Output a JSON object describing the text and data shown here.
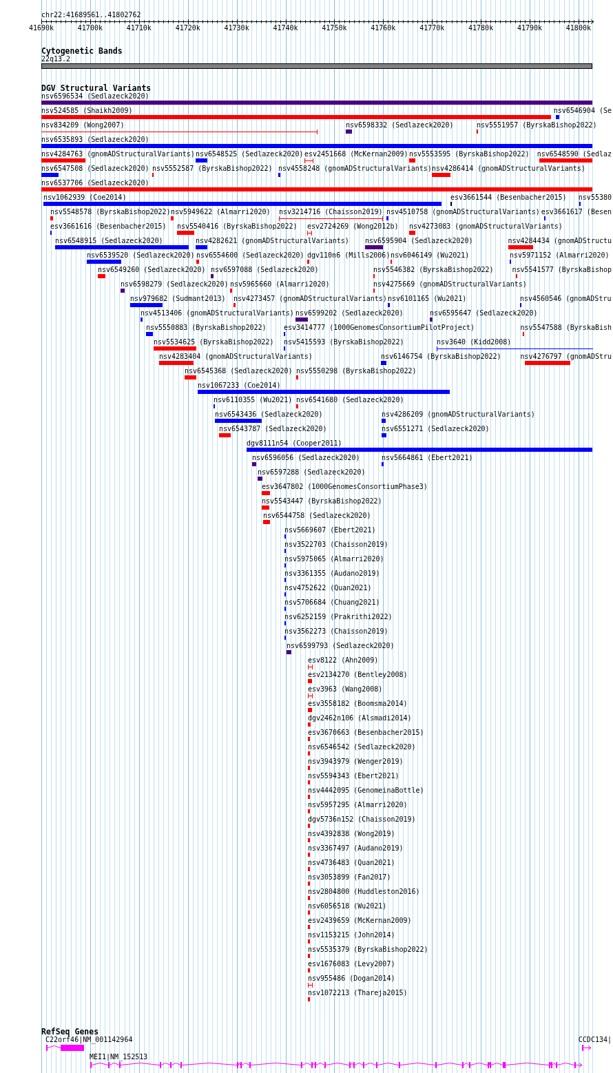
{
  "locus": "chr22:41689561..41802762",
  "ruler": {
    "ticks": [
      "41690k",
      "41700k",
      "41710k",
      "41720k",
      "41730k",
      "41740k",
      "41750k",
      "41760k",
      "41770k",
      "41780k",
      "41790k",
      "41800k"
    ]
  },
  "cytoband_track": {
    "title": "Cytogenetic Bands",
    "band": "22q13.2"
  },
  "dgv_track": {
    "title": "DGV Structural Variants",
    "features": [
      {
        "label": "nsv6596534 (Sedlazeck2020)",
        "color": "#4b0082",
        "kind": "block"
      },
      {
        "label": "nsv524585 (Shaikh2009)",
        "color": "#ff0000",
        "kind": "block"
      },
      {
        "label": "nsv6546904 (Se",
        "color": "#0000ff",
        "kind": "block"
      },
      {
        "label": "nsv834209 (Wong2007)",
        "color": "#ff0000",
        "kind": "span"
      },
      {
        "label": "nsv6598332 (Sedlazeck2020)",
        "color": "#4b0082",
        "kind": "block"
      },
      {
        "label": "nsv5551957 (ByrskaBishop2022)",
        "color": "#ff0000",
        "kind": "block"
      },
      {
        "label": "nsv6535893 (Sedlazeck2020)",
        "color": "#0000ff",
        "kind": "block"
      },
      {
        "label": "nsv4284763 (gnomADStructuralVariants)",
        "color": "#ff0000",
        "kind": "block"
      },
      {
        "label": "nsv6548525 (Sedlazeck2020)",
        "color": "#0000ff",
        "kind": "block"
      },
      {
        "label": "esv2451668 (McKernan2009)",
        "color": "#ff0000",
        "kind": "span"
      },
      {
        "label": "nsv5553595 (ByrskaBishop2022)",
        "color": "#ff0000",
        "kind": "block"
      },
      {
        "label": "nsv6548590 (Sedlaz",
        "color": "#ff0000",
        "kind": "block"
      },
      {
        "label": "nsv6547508 (Sedlazeck2020)",
        "color": "#0000ff",
        "kind": "block"
      },
      {
        "label": "nsv5552587 (ByrskaBishop2022)",
        "color": "#ff0000",
        "kind": "block"
      },
      {
        "label": "nsv4558248 (gnomADStructuralVariants)",
        "color": "#0000ff",
        "kind": "block"
      },
      {
        "label": "nsv4286414 (gnomADStructuralVariants)",
        "color": "#ff0000",
        "kind": "block"
      },
      {
        "label": "nsv6537706 (Sedlazeck2020)",
        "color": "#ff0000",
        "kind": "block"
      },
      {
        "label": "nsv1062939 (Coe2014)",
        "color": "#0000ff",
        "kind": "block"
      },
      {
        "label": "esv3661544 (Besenbacher2015)",
        "color": "#000000",
        "kind": "block"
      },
      {
        "label": "nsv55380",
        "color": "#0000ff",
        "kind": "block"
      },
      {
        "label": "nsv5548578 (ByrskaBishop2022)",
        "color": "#ff0000",
        "kind": "block"
      },
      {
        "label": "nsv5949622 (Almarri2020)",
        "color": "#ff0000",
        "kind": "block"
      },
      {
        "label": "nsv3214716 (Chaisson2019)",
        "color": "#ff0000",
        "kind": "span"
      },
      {
        "label": "nsv4510758 (gnomADStructuralVariants)",
        "color": "#0000ff",
        "kind": "block"
      },
      {
        "label": "esv3661617 (Besen",
        "color": "#0000ff",
        "kind": "block"
      },
      {
        "label": "esv3661616 (Besenbacher2015)",
        "color": "#0000ff",
        "kind": "block"
      },
      {
        "label": "nsv5540416 (ByrskaBishop2022)",
        "color": "#ff0000",
        "kind": "block"
      },
      {
        "label": "esv2724269 (Wong2012b)",
        "color": "#ff0000",
        "kind": "span"
      },
      {
        "label": "nsv4273083 (gnomADStructuralVariants)",
        "color": "#ff0000",
        "kind": "block"
      },
      {
        "label": "nsv6548915 (Sedlazeck2020)",
        "color": "#0000ff",
        "kind": "block"
      },
      {
        "label": "nsv4282621 (gnomADStructuralVariants)",
        "color": "#0000ff",
        "kind": "block"
      },
      {
        "label": "nsv6595904 (Sedlazeck2020)",
        "color": "#4b0082",
        "kind": "block"
      },
      {
        "label": "nsv4284434 (gnomADStructu",
        "color": "#ff0000",
        "kind": "block"
      },
      {
        "label": "nsv6539520 (Sedlazeck2020)",
        "color": "#0000ff",
        "kind": "block"
      },
      {
        "label": "nsv6554600 (Sedlazeck2020)",
        "color": "#ff0000",
        "kind": "block"
      },
      {
        "label": "dgv110n6 (Mills2006)",
        "color": "#ff0000",
        "kind": "block"
      },
      {
        "label": "nsv6046149 (Wu2021)",
        "color": "#ff0000",
        "kind": "block"
      },
      {
        "label": "nsv5971152 (Almarri2020)",
        "color": "#0000ff",
        "kind": "block"
      },
      {
        "label": "nsv6549260 (Sedlazeck2020)",
        "color": "#ff0000",
        "kind": "block"
      },
      {
        "label": "nsv6597088 (Sedlazeck2020)",
        "color": "#4b0082",
        "kind": "block"
      },
      {
        "label": "nsv5546382 (ByrskaBishop2022)",
        "color": "#ff0000",
        "kind": "block"
      },
      {
        "label": "nsv5541577 (ByrskaBishop",
        "color": "#ff0000",
        "kind": "block"
      },
      {
        "label": "nsv6598279 (Sedlazeck2020)",
        "color": "#4b0082",
        "kind": "block"
      },
      {
        "label": "nsv5965660 (Almarri2020)",
        "color": "#ff0000",
        "kind": "block"
      },
      {
        "label": "nsv4275669 (gnomADStructuralVariants)",
        "color": "#ff0000",
        "kind": "block"
      },
      {
        "label": "nsv979682 (Sudmant2013)",
        "color": "#0000ff",
        "kind": "block"
      },
      {
        "label": "nsv4273457 (gnomADStructuralVariants)",
        "color": "#ff0000",
        "kind": "block"
      },
      {
        "label": "nsv6101165 (Wu2021)",
        "color": "#0000ff",
        "kind": "block"
      },
      {
        "label": "nsv4560546 (gnomADStru",
        "color": "#0000ff",
        "kind": "block"
      },
      {
        "label": "nsv4513406 (gnomADStructuralVariants)",
        "color": "#0000ff",
        "kind": "block"
      },
      {
        "label": "nsv6599202 (Sedlazeck2020)",
        "color": "#4b0082",
        "kind": "block"
      },
      {
        "label": "nsv6595647 (Sedlazeck2020)",
        "color": "#4b0082",
        "kind": "block"
      },
      {
        "label": "nsv5550883 (ByrskaBishop2022)",
        "color": "#0000ff",
        "kind": "block"
      },
      {
        "label": "esv3414777 (1000GenomesConsortiumPilotProject)",
        "color": "#0000ff",
        "kind": "block"
      },
      {
        "label": "nsv5547588 (ByrskaBish",
        "color": "#ff0000",
        "kind": "block"
      },
      {
        "label": "nsv5534625 (ByrskaBishop2022)",
        "color": "#ff0000",
        "kind": "block"
      },
      {
        "label": "nsv5415593 (ByrskaBishop2022)",
        "color": "#0000ff",
        "kind": "block"
      },
      {
        "label": "nsv3640 (Kidd2008)",
        "color": "#0000ff",
        "kind": "span"
      },
      {
        "label": "nsv4283404 (gnomADStructuralVariants)",
        "color": "#ff0000",
        "kind": "block"
      },
      {
        "label": "nsv6146754 (ByrskaBishop2022)",
        "color": "#0000ff",
        "kind": "block"
      },
      {
        "label": "nsv4276797 (gnomADStru",
        "color": "#ff0000",
        "kind": "block"
      },
      {
        "label": "nsv6545368 (Sedlazeck2020)",
        "color": "#ff0000",
        "kind": "block"
      },
      {
        "label": "nsv5550298 (ByrskaBishop2022)",
        "color": "#ff0000",
        "kind": "block"
      },
      {
        "label": "nsv1067233 (Coe2014)",
        "color": "#0000ff",
        "kind": "block"
      },
      {
        "label": "nsv6110355 (Wu2021)",
        "color": "#0000ff",
        "kind": "block"
      },
      {
        "label": "nsv6541680 (Sedlazeck2020)",
        "color": "#ff0000",
        "kind": "block"
      },
      {
        "label": "nsv6543436 (Sedlazeck2020)",
        "color": "#0000ff",
        "kind": "block"
      },
      {
        "label": "nsv4286209 (gnomADStructuralVariants)",
        "color": "#0000ff",
        "kind": "block"
      },
      {
        "label": "nsv6543787 (Sedlazeck2020)",
        "color": "#ff0000",
        "kind": "block"
      },
      {
        "label": "nsv6551271 (Sedlazeck2020)",
        "color": "#0000ff",
        "kind": "block"
      },
      {
        "label": "dgv8111n54 (Cooper2011)",
        "color": "#0000ff",
        "kind": "block"
      },
      {
        "label": "nsv6596056 (Sedlazeck2020)",
        "color": "#4b0082",
        "kind": "block"
      },
      {
        "label": "nsv5664861 (Ebert2021)",
        "color": "#0000ff",
        "kind": "block"
      },
      {
        "label": "nsv6597288 (Sedlazeck2020)",
        "color": "#4b0082",
        "kind": "block"
      },
      {
        "label": "esv3647802 (1000GenomesConsortiumPhase3)",
        "color": "#ff0000",
        "kind": "block"
      },
      {
        "label": "nsv5543447 (ByrskaBishop2022)",
        "color": "#ff0000",
        "kind": "block"
      },
      {
        "label": "nsv6544758 (Sedlazeck2020)",
        "color": "#ff0000",
        "kind": "block"
      },
      {
        "label": "nsv5669607 (Ebert2021)",
        "color": "#0000ff",
        "kind": "block"
      },
      {
        "label": "nsv3522703 (Chaisson2019)",
        "color": "#0000ff",
        "kind": "block"
      },
      {
        "label": "nsv5975065 (Almarri2020)",
        "color": "#0000ff",
        "kind": "block"
      },
      {
        "label": "nsv3361355 (Audano2019)",
        "color": "#0000ff",
        "kind": "block"
      },
      {
        "label": "nsv4752622 (Quan2021)",
        "color": "#0000ff",
        "kind": "block"
      },
      {
        "label": "nsv5706684 (Chuang2021)",
        "color": "#0000ff",
        "kind": "block"
      },
      {
        "label": "nsv6252159 (Prakrithi2022)",
        "color": "#0000ff",
        "kind": "block"
      },
      {
        "label": "nsv3562273 (Chaisson2019)",
        "color": "#0000ff",
        "kind": "block"
      },
      {
        "label": "nsv6599793 (Sedlazeck2020)",
        "color": "#4b0082",
        "kind": "block"
      },
      {
        "label": "esv8122 (Ahn2009)",
        "color": "#ff0000",
        "kind": "span"
      },
      {
        "label": "esv2134270 (Bentley2008)",
        "color": "#ff0000",
        "kind": "block"
      },
      {
        "label": "esv3963 (Wang2008)",
        "color": "#ff0000",
        "kind": "span"
      },
      {
        "label": "esv3558182 (Boomsma2014)",
        "color": "#ff0000",
        "kind": "block"
      },
      {
        "label": "dgv2462n106 (Alsmadi2014)",
        "color": "#ff0000",
        "kind": "block"
      },
      {
        "label": "esv3670663 (Besenbacher2015)",
        "color": "#ff0000",
        "kind": "block"
      },
      {
        "label": "nsv6546542 (Sedlazeck2020)",
        "color": "#ff0000",
        "kind": "block"
      },
      {
        "label": "nsv3943979 (Wenger2019)",
        "color": "#ff0000",
        "kind": "block"
      },
      {
        "label": "nsv5594343 (Ebert2021)",
        "color": "#ff0000",
        "kind": "block"
      },
      {
        "label": "nsv4442095 (GenomeinaBottle)",
        "color": "#ff0000",
        "kind": "block"
      },
      {
        "label": "nsv5957295 (Almarri2020)",
        "color": "#ff0000",
        "kind": "block"
      },
      {
        "label": "dgv5736n152 (Chaisson2019)",
        "color": "#ff0000",
        "kind": "block"
      },
      {
        "label": "nsv4392838 (Wong2019)",
        "color": "#ff0000",
        "kind": "block"
      },
      {
        "label": "nsv3367497 (Audano2019)",
        "color": "#ff0000",
        "kind": "block"
      },
      {
        "label": "nsv4736483 (Quan2021)",
        "color": "#ff0000",
        "kind": "block"
      },
      {
        "label": "nsv3053899 (Fan2017)",
        "color": "#ff0000",
        "kind": "block"
      },
      {
        "label": "nsv2804800 (Huddleston2016)",
        "color": "#ff0000",
        "kind": "block"
      },
      {
        "label": "nsv6056518 (Wu2021)",
        "color": "#ff0000",
        "kind": "block"
      },
      {
        "label": "esv2439659 (McKernan2009)",
        "color": "#ff0000",
        "kind": "block"
      },
      {
        "label": "nsv1153215 (John2014)",
        "color": "#ff0000",
        "kind": "block"
      },
      {
        "label": "nsv5535379 (ByrskaBishop2022)",
        "color": "#ff0000",
        "kind": "block"
      },
      {
        "label": "esv1676083 (Levy2007)",
        "color": "#ff0000",
        "kind": "block"
      },
      {
        "label": "nsv955486 (Dogan2014)",
        "color": "#ff0000",
        "kind": "span"
      },
      {
        "label": "nsv1072213 (Thareja2015)",
        "color": "#ff0000",
        "kind": "block"
      }
    ]
  },
  "refseq_track": {
    "title": "RefSeq Genes",
    "genes": [
      {
        "label": "C22orf46|NM_001142964"
      },
      {
        "label": "CCDC134|"
      },
      {
        "label": "MEI1|NM_152513"
      }
    ]
  }
}
